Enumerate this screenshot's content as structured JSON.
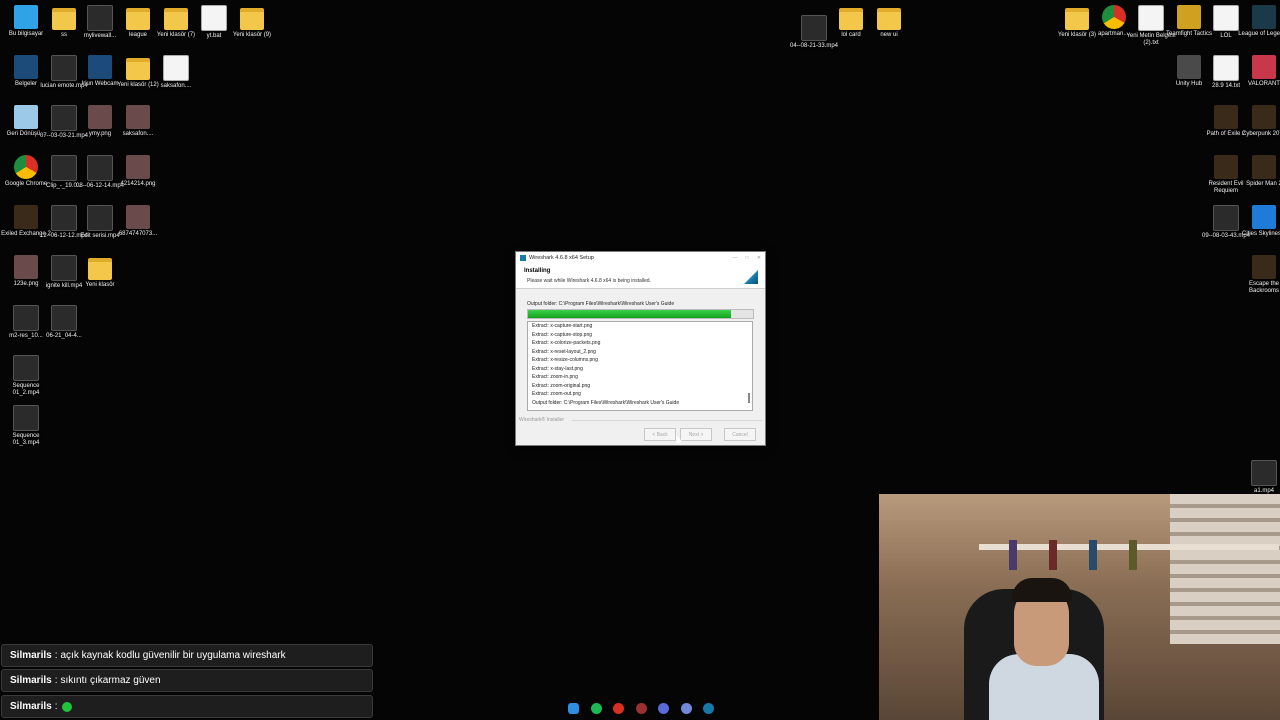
{
  "desktop_left": [
    {
      "label": "Bu bilgisayar",
      "icon": "computer-icon"
    },
    {
      "label": "ss",
      "icon": "folder-icon"
    },
    {
      "label": "mylivewall...",
      "icon": "video-file-icon"
    },
    {
      "label": "league",
      "icon": "folder-icon"
    },
    {
      "label": "Yeni klasör (7)",
      "icon": "folder-icon"
    },
    {
      "label": "yt.bat",
      "icon": "batch-file-icon"
    },
    {
      "label": "Yeni klasör (9)",
      "icon": "folder-icon"
    },
    {
      "label": "Belgeler",
      "icon": "documents-icon"
    },
    {
      "label": "lucian emote.mp4",
      "icon": "video-file-icon"
    },
    {
      "label": "Iriun Webcam",
      "icon": "webcam-app-icon"
    },
    {
      "label": "Yeni klasör (12)",
      "icon": "folder-icon"
    },
    {
      "label": "saksafon....",
      "icon": "audio-file-icon"
    },
    {
      "label": "Geri Dönüşü...",
      "icon": "recycle-bin-icon"
    },
    {
      "label": "07--03-03-21.mp4",
      "icon": "video-file-icon"
    },
    {
      "label": "ymy.png",
      "icon": "image-file-icon"
    },
    {
      "label": "saksafon....",
      "icon": "image-file-icon"
    },
    {
      "label": "Google Chrome",
      "icon": "chrome-icon"
    },
    {
      "label": "Clip_-_19.0...",
      "icon": "video-file-icon"
    },
    {
      "label": "08--06-12-14.mp4",
      "icon": "video-file-icon"
    },
    {
      "label": "4214214.png",
      "icon": "image-file-icon"
    },
    {
      "label": "Exiled Exchange 2",
      "icon": "game-icon"
    },
    {
      "label": "12--06-12-12.mp4",
      "icon": "video-file-icon"
    },
    {
      "label": "Edit serisi.mp4",
      "icon": "video-file-icon"
    },
    {
      "label": "6874747073...",
      "icon": "image-file-icon"
    },
    {
      "label": "123e.png",
      "icon": "image-file-icon"
    },
    {
      "label": "ignite kill.mp4",
      "icon": "video-file-icon"
    },
    {
      "label": "Yeni klasör",
      "icon": "folder-icon"
    },
    {
      "label": "m2-res_10...",
      "icon": "video-file-icon"
    },
    {
      "label": "06-21_04-4...",
      "icon": "video-file-icon"
    },
    {
      "label": "Sequence 01_2.mp4",
      "icon": "video-file-icon"
    },
    {
      "label": "Sequence 01_3.mp4",
      "icon": "video-file-icon"
    }
  ],
  "desktop_center": [
    {
      "label": "04--08-21-33.mp4",
      "icon": "video-file-icon"
    },
    {
      "label": "lol card",
      "icon": "folder-icon"
    },
    {
      "label": "new ui",
      "icon": "folder-icon"
    }
  ],
  "desktop_right": [
    {
      "label": "Yeni klasör (3)",
      "icon": "folder-icon"
    },
    {
      "label": "apartman....",
      "icon": "chrome-icon"
    },
    {
      "label": "Yeni Metin Belgesi (2).txt",
      "icon": "text-file-icon"
    },
    {
      "label": "Teamfight Tactics",
      "icon": "tft-icon"
    },
    {
      "label": "LOL",
      "icon": "text-file-icon"
    },
    {
      "label": "League of Legends",
      "icon": "lol-icon"
    },
    {
      "label": "Unity Hub",
      "icon": "unity-icon"
    },
    {
      "label": "28.9 14.txt",
      "icon": "text-file-icon"
    },
    {
      "label": "VALORANT",
      "icon": "valorant-icon"
    },
    {
      "label": "Path of Exile 2",
      "icon": "game-icon"
    },
    {
      "label": "Cyberpunk 2077",
      "icon": "game-icon"
    },
    {
      "label": "Resident Evil Requiem",
      "icon": "game-icon"
    },
    {
      "label": "Spider Man 2",
      "icon": "game-icon"
    },
    {
      "label": "09--08-03-43.mp4",
      "icon": "video-file-icon"
    },
    {
      "label": "Cities Skylines II",
      "icon": "cities-icon"
    },
    {
      "label": "Escape the Backrooms",
      "icon": "game-icon"
    },
    {
      "label": "a1.mp4",
      "icon": "video-file-icon"
    }
  ],
  "installer": {
    "title": "Wireshark 4.6.8 x64 Setup",
    "minimize": "—",
    "maximize": "□",
    "close": "✕",
    "heading": "Installing",
    "subheading": "Please wait while Wireshark 4.6.8 x64 is being installed.",
    "output_folder": "Output folder: C:\\Program Files\\Wireshark\\Wireshark User's Guide",
    "progress": 0.9,
    "log_lines": [
      "Extract: x-capture-start.png",
      "Extract: x-capture-stop.png",
      "Extract: x-colorize-packets.png",
      "Extract: x-reset-layout_2.png",
      "Extract: x-resize-columns.png",
      "Extract: x-stay-last.png",
      "Extract: zoom-in.png",
      "Extract: zoom-original.png",
      "Extract: zoom-out.png",
      "Output folder: C:\\Program Files\\Wireshark\\Wireshark User's Guide"
    ],
    "brand": "Wireshark® Installer",
    "back_label": "< Back",
    "next_label": "Next >",
    "cancel_label": "Cancel"
  },
  "chat": [
    {
      "user": "Silmarils",
      "sep": ":",
      "message": "açık kaynak kodlu güvenilir bir uygulama wireshark"
    },
    {
      "user": "Silmarils",
      "sep": ":",
      "message": "sıkıntı çıkarmaz güven"
    },
    {
      "user": "Silmarils",
      "sep": ":",
      "message": ""
    }
  ],
  "taskbar": [
    {
      "name": "start-icon",
      "color": "#2f8de4"
    },
    {
      "name": "spotify-icon",
      "color": "#1db954"
    },
    {
      "name": "chrome-icon",
      "color": "#d93025"
    },
    {
      "name": "obs-icon",
      "color": "#9a3030"
    },
    {
      "name": "app-icon",
      "color": "#5a6ad8"
    },
    {
      "name": "discord-icon",
      "color": "#7289da"
    },
    {
      "name": "wireshark-icon",
      "color": "#1679a7"
    }
  ]
}
